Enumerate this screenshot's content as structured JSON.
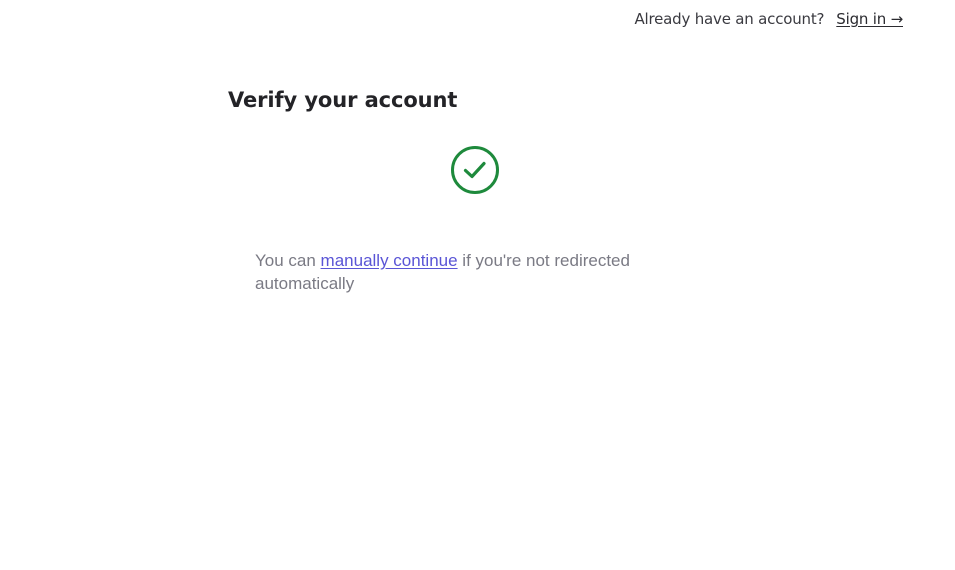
{
  "header": {
    "question": "Already have an account?",
    "signin_label": "Sign in →"
  },
  "main": {
    "title": "Verify your account",
    "status_icon": "check-circle-icon",
    "status_color": "#1e8a3c",
    "message_before": "You can ",
    "continue_link": "manually continue",
    "message_after": " if you're not redirected automatically",
    "link_color": "#5a55d6"
  }
}
